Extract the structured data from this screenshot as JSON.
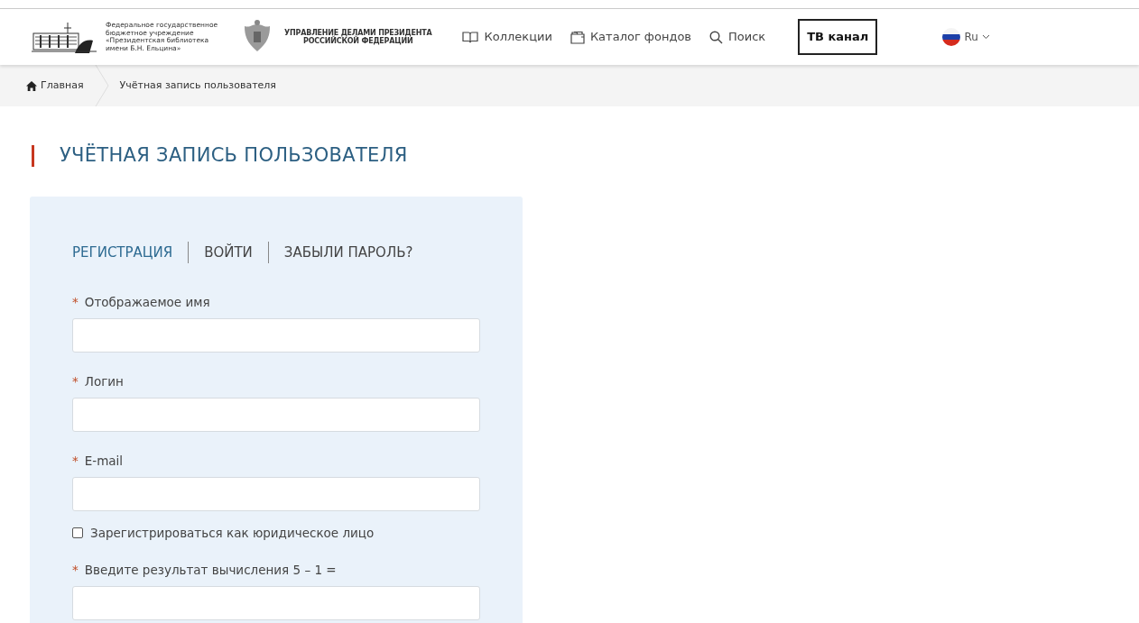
{
  "header": {
    "org_text": "Федеральное государственное\nбюджетное учреждение\n«Президентская библиотека\nимени Б.Н. Ельцина»",
    "admin_text": "УПРАВЛЕНИЕ ДЕЛАМИ ПРЕЗИДЕНТА\nРОССИЙСКОЙ ФЕДЕРАЦИИ",
    "nav": [
      {
        "label": "Коллекции",
        "kind": "book"
      },
      {
        "label": "Каталог фондов",
        "kind": "folder"
      },
      {
        "label": "Поиск",
        "kind": "search"
      }
    ],
    "tv_button": "ТВ канал",
    "language": "Ru"
  },
  "breadcrumbs": [
    "Главная",
    "Учётная запись пользователя"
  ],
  "page_title": "УЧЁТНАЯ ЗАПИСЬ ПОЛЬЗОВАТЕЛЯ",
  "tabs": [
    {
      "label": "РЕГИСТРАЦИЯ",
      "selected": true
    },
    {
      "label": "ВОЙТИ",
      "selected": false
    },
    {
      "label": "ЗАБЫЛИ ПАРОЛЬ?",
      "selected": false
    }
  ],
  "fields": [
    {
      "kind": "text",
      "label": "Отображаемое имя",
      "marker": "*"
    },
    {
      "kind": "text",
      "label": "Логин",
      "marker": "*"
    },
    {
      "kind": "text",
      "label": "E-mail",
      "marker": "*"
    },
    {
      "kind": "checkbox",
      "label": "Зарегистрироваться как юридическое лицо",
      "checked": false
    },
    {
      "kind": "text",
      "label": "Введите результат вычисления 5 – 1 =",
      "marker": "*"
    }
  ]
}
